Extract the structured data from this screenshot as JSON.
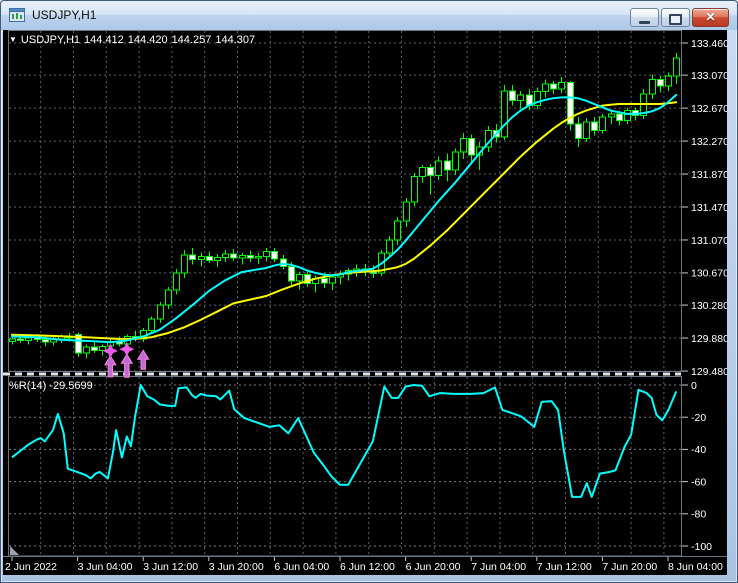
{
  "window": {
    "title": "USDJPY,H1",
    "controls": {
      "minimize": "minimize",
      "restore": "restore",
      "close": "✕"
    }
  },
  "main_chart": {
    "collapse_icon": "▼",
    "ohlc": {
      "symbol": "USDJPY,H1",
      "open": "144.412",
      "high": "144.420",
      "low": "144.257",
      "close": "144.307"
    }
  },
  "indicator": {
    "label": "%R(14) -29.5699"
  },
  "colors": {
    "background": "#000000",
    "grid": "#59636c",
    "wpr_grid": "#737d86",
    "panel_border": "#6b7680",
    "candle_outline": "#00FF00",
    "bull_fill": "#000000",
    "bear_fill": "#FFFFFF",
    "ma_fast": "#00FFFF",
    "ma_slow": "#FFFF00",
    "wpr_line": "#00FFFF",
    "signal_arrow": "#c06ad8",
    "signal_arrow_edge": "#ff80e0",
    "signal_star": "#ee5aee",
    "axis_text": "#FFFFFF",
    "tick": "#c8c8c8",
    "divider_dash": "#e0e4e9"
  },
  "chart_data": {
    "type": "candlestick",
    "symbol": "USDJPY",
    "timeframe": "H1",
    "price_axis": {
      "texts": [
        "133.460",
        "133.070",
        "132.670",
        "132.270",
        "131.870",
        "131.470",
        "131.070",
        "130.670",
        "130.280",
        "129.880",
        "129.480"
      ],
      "values": [
        133.46,
        133.07,
        132.67,
        132.27,
        131.87,
        131.47,
        131.07,
        130.67,
        130.28,
        129.88,
        129.48
      ],
      "min": 129.48,
      "max": 133.46
    },
    "wpr_axis": {
      "texts": [
        "0",
        "-20",
        "-40",
        "-60",
        "-80",
        "-100"
      ],
      "values": [
        0,
        -20,
        -40,
        -60,
        -80,
        -100
      ],
      "min": -100,
      "max": 0
    },
    "time_axis": {
      "labels": [
        "2 Jun 2022",
        "3 Jun 04:00",
        "3 Jun 12:00",
        "3 Jun 20:00",
        "6 Jun 04:00",
        "6 Jun 12:00",
        "6 Jun 20:00",
        "7 Jun 04:00",
        "7 Jun 12:00",
        "7 Jun 20:00",
        "8 Jun 04:00"
      ],
      "tick_indices": [
        0,
        8,
        16,
        24,
        32,
        40,
        48,
        56,
        64,
        72,
        80
      ]
    },
    "candles": [
      [
        129.84,
        129.9,
        129.8,
        129.87
      ],
      [
        129.87,
        129.91,
        129.82,
        129.85
      ],
      [
        129.85,
        129.89,
        129.8,
        129.88
      ],
      [
        129.88,
        129.93,
        129.83,
        129.86
      ],
      [
        129.86,
        129.9,
        129.78,
        129.83
      ],
      [
        129.83,
        129.89,
        129.79,
        129.87
      ],
      [
        129.87,
        129.92,
        129.82,
        129.9
      ],
      [
        129.9,
        129.94,
        129.84,
        129.88
      ],
      [
        129.92,
        129.95,
        129.65,
        129.7
      ],
      [
        129.7,
        129.8,
        129.63,
        129.77
      ],
      [
        129.77,
        129.83,
        129.7,
        129.73
      ],
      [
        129.73,
        129.8,
        129.67,
        129.78
      ],
      [
        129.78,
        129.86,
        129.76,
        129.84
      ],
      [
        129.84,
        129.9,
        129.78,
        129.81
      ],
      [
        129.81,
        129.92,
        129.78,
        129.9
      ],
      [
        129.9,
        129.97,
        129.84,
        129.87
      ],
      [
        129.87,
        130.0,
        129.83,
        129.97
      ],
      [
        129.97,
        130.14,
        129.93,
        130.11
      ],
      [
        130.11,
        130.32,
        130.06,
        130.28
      ],
      [
        130.28,
        130.5,
        130.23,
        130.46
      ],
      [
        130.46,
        130.72,
        130.41,
        130.67
      ],
      [
        130.67,
        130.95,
        130.61,
        130.89
      ],
      [
        130.89,
        130.97,
        130.77,
        130.83
      ],
      [
        130.83,
        130.92,
        130.75,
        130.87
      ],
      [
        130.87,
        130.93,
        130.79,
        130.82
      ],
      [
        130.82,
        130.9,
        130.74,
        130.86
      ],
      [
        130.86,
        130.95,
        130.8,
        130.9
      ],
      [
        130.9,
        130.96,
        130.82,
        130.85
      ],
      [
        130.85,
        130.91,
        130.77,
        130.88
      ],
      [
        130.88,
        130.94,
        130.8,
        130.85
      ],
      [
        130.85,
        130.92,
        130.78,
        130.87
      ],
      [
        130.87,
        130.97,
        130.81,
        130.93
      ],
      [
        130.93,
        130.97,
        130.8,
        130.84
      ],
      [
        130.84,
        130.89,
        130.71,
        130.75
      ],
      [
        130.75,
        130.8,
        130.52,
        130.57
      ],
      [
        130.57,
        130.69,
        130.47,
        130.65
      ],
      [
        130.65,
        130.71,
        130.5,
        130.54
      ],
      [
        130.54,
        130.64,
        130.43,
        130.6
      ],
      [
        130.6,
        130.67,
        130.49,
        130.55
      ],
      [
        130.55,
        130.66,
        130.46,
        130.62
      ],
      [
        130.62,
        130.7,
        130.53,
        130.66
      ],
      [
        130.66,
        130.73,
        130.58,
        130.7
      ],
      [
        130.7,
        130.77,
        130.62,
        130.72
      ],
      [
        130.72,
        130.78,
        130.63,
        130.68
      ],
      [
        130.68,
        130.76,
        130.61,
        130.67
      ],
      [
        130.67,
        130.95,
        130.63,
        130.91
      ],
      [
        130.91,
        131.12,
        130.85,
        131.07
      ],
      [
        131.07,
        131.35,
        131.01,
        131.3
      ],
      [
        131.3,
        131.58,
        131.23,
        131.53
      ],
      [
        131.53,
        131.88,
        131.48,
        131.84
      ],
      [
        131.84,
        131.98,
        131.76,
        131.95
      ],
      [
        131.95,
        131.99,
        131.62,
        131.85
      ],
      [
        131.85,
        132.08,
        131.8,
        132.03
      ],
      [
        132.03,
        132.12,
        131.78,
        131.92
      ],
      [
        131.92,
        132.18,
        131.86,
        132.14
      ],
      [
        132.14,
        132.37,
        132.05,
        132.3
      ],
      [
        132.3,
        132.35,
        132.0,
        132.1
      ],
      [
        132.1,
        132.26,
        131.92,
        132.2
      ],
      [
        132.2,
        132.45,
        132.14,
        132.4
      ],
      [
        132.4,
        132.48,
        132.25,
        132.32
      ],
      [
        132.32,
        132.95,
        132.28,
        132.88
      ],
      [
        132.88,
        132.95,
        132.7,
        132.76
      ],
      [
        132.76,
        132.88,
        132.66,
        132.83
      ],
      [
        132.83,
        132.9,
        132.64,
        132.7
      ],
      [
        132.7,
        132.92,
        132.66,
        132.87
      ],
      [
        132.87,
        133.02,
        132.8,
        132.96
      ],
      [
        132.96,
        133.0,
        132.84,
        132.9
      ],
      [
        132.9,
        133.05,
        132.85,
        132.98
      ],
      [
        132.98,
        133.0,
        132.4,
        132.48
      ],
      [
        132.48,
        132.56,
        132.2,
        132.3
      ],
      [
        132.3,
        132.55,
        132.26,
        132.5
      ],
      [
        132.5,
        132.56,
        132.34,
        132.4
      ],
      [
        132.4,
        132.6,
        132.36,
        132.56
      ],
      [
        132.56,
        132.64,
        132.48,
        132.6
      ],
      [
        132.6,
        132.64,
        132.46,
        132.52
      ],
      [
        132.52,
        132.68,
        132.48,
        132.64
      ],
      [
        132.64,
        132.68,
        132.52,
        132.58
      ],
      [
        132.58,
        132.9,
        132.54,
        132.84
      ],
      [
        132.84,
        133.08,
        132.78,
        133.02
      ],
      [
        133.02,
        133.06,
        132.86,
        132.94
      ],
      [
        132.94,
        133.1,
        132.88,
        133.06
      ],
      [
        133.06,
        133.34,
        132.96,
        133.28
      ]
    ],
    "ma_fast_cyan": [
      [
        0,
        129.9
      ],
      [
        3,
        129.89
      ],
      [
        6,
        129.86
      ],
      [
        10,
        129.84
      ],
      [
        12,
        129.83
      ],
      [
        14,
        129.85
      ],
      [
        16,
        129.9
      ],
      [
        18,
        129.98
      ],
      [
        20,
        130.12
      ],
      [
        22,
        130.28
      ],
      [
        24,
        130.45
      ],
      [
        26,
        130.58
      ],
      [
        28,
        130.68
      ],
      [
        31,
        130.73
      ],
      [
        32,
        130.76
      ],
      [
        33,
        130.78
      ],
      [
        34,
        130.77
      ],
      [
        35,
        130.74
      ],
      [
        36,
        130.7
      ],
      [
        37,
        130.67
      ],
      [
        38,
        130.65
      ],
      [
        39,
        130.64
      ],
      [
        40,
        130.65
      ],
      [
        41,
        130.68
      ],
      [
        44,
        130.72
      ],
      [
        45,
        130.78
      ],
      [
        46,
        130.86
      ],
      [
        47,
        130.95
      ],
      [
        48,
        131.06
      ],
      [
        49,
        131.18
      ],
      [
        50,
        131.3
      ],
      [
        51,
        131.42
      ],
      [
        52,
        131.54
      ],
      [
        53,
        131.65
      ],
      [
        54,
        131.76
      ],
      [
        55,
        131.88
      ],
      [
        56,
        132.0
      ],
      [
        57,
        132.12
      ],
      [
        58,
        132.24
      ],
      [
        59,
        132.35
      ],
      [
        60,
        132.46
      ],
      [
        61,
        132.56
      ],
      [
        62,
        132.64
      ],
      [
        63,
        132.7
      ],
      [
        64,
        132.74
      ],
      [
        65,
        132.77
      ],
      [
        66,
        132.79
      ],
      [
        67,
        132.8
      ],
      [
        68,
        132.8
      ],
      [
        69,
        132.79
      ],
      [
        70,
        132.76
      ],
      [
        71,
        132.72
      ],
      [
        72,
        132.68
      ],
      [
        73,
        132.64
      ],
      [
        74,
        132.62
      ],
      [
        75,
        132.6
      ],
      [
        76,
        132.6
      ],
      [
        77,
        132.61
      ],
      [
        78,
        132.63
      ],
      [
        79,
        132.67
      ],
      [
        80,
        132.74
      ],
      [
        81,
        132.83
      ]
    ],
    "ma_slow_yellow": [
      [
        0,
        129.92
      ],
      [
        4,
        129.91
      ],
      [
        9,
        129.89
      ],
      [
        13,
        129.87
      ],
      [
        15,
        129.87
      ],
      [
        17,
        129.89
      ],
      [
        19,
        129.94
      ],
      [
        21,
        130.01
      ],
      [
        23,
        130.1
      ],
      [
        25,
        130.2
      ],
      [
        27,
        130.3
      ],
      [
        31,
        130.39
      ],
      [
        33,
        130.47
      ],
      [
        35,
        130.54
      ],
      [
        37,
        130.6
      ],
      [
        39,
        130.64
      ],
      [
        41,
        130.67
      ],
      [
        45,
        130.7
      ],
      [
        47,
        130.74
      ],
      [
        48,
        130.78
      ],
      [
        49,
        130.84
      ],
      [
        50,
        130.92
      ],
      [
        51,
        131.0
      ],
      [
        52,
        131.09
      ],
      [
        53,
        131.18
      ],
      [
        54,
        131.28
      ],
      [
        55,
        131.38
      ],
      [
        56,
        131.48
      ],
      [
        57,
        131.58
      ],
      [
        58,
        131.68
      ],
      [
        59,
        131.78
      ],
      [
        60,
        131.88
      ],
      [
        61,
        131.98
      ],
      [
        62,
        132.08
      ],
      [
        63,
        132.17
      ],
      [
        64,
        132.26
      ],
      [
        65,
        132.34
      ],
      [
        66,
        132.42
      ],
      [
        67,
        132.49
      ],
      [
        68,
        132.55
      ],
      [
        69,
        132.6
      ],
      [
        70,
        132.64
      ],
      [
        71,
        132.67
      ],
      [
        72,
        132.7
      ],
      [
        73,
        132.71
      ],
      [
        74,
        132.72
      ],
      [
        75,
        132.72
      ],
      [
        77,
        132.72
      ],
      [
        79,
        132.72
      ],
      [
        80,
        132.73
      ],
      [
        81,
        132.74
      ]
    ],
    "wpr": [
      [
        0,
        -45
      ],
      [
        1,
        -41
      ],
      [
        2,
        -37
      ],
      [
        3,
        -34
      ],
      [
        3.5,
        -33
      ],
      [
        4,
        -35
      ],
      [
        5,
        -28
      ],
      [
        5.6,
        -18
      ],
      [
        6.3,
        -30
      ],
      [
        6.8,
        -52
      ],
      [
        8.5,
        -55
      ],
      [
        9,
        -56
      ],
      [
        9.6,
        -58
      ],
      [
        10.2,
        -55
      ],
      [
        10.7,
        -54
      ],
      [
        11.2,
        -56
      ],
      [
        11.7,
        -58
      ],
      [
        12.3,
        -42
      ],
      [
        12.7,
        -28
      ],
      [
        13.4,
        -45
      ],
      [
        14,
        -32
      ],
      [
        14.5,
        -38
      ],
      [
        15,
        -20
      ],
      [
        15.7,
        0
      ],
      [
        16.5,
        -7
      ],
      [
        17.3,
        -9
      ],
      [
        18,
        -12
      ],
      [
        19.1,
        -13
      ],
      [
        19.9,
        -13
      ],
      [
        20.3,
        -2
      ],
      [
        21.3,
        -1.5
      ],
      [
        21.9,
        -6
      ],
      [
        22.4,
        -8
      ],
      [
        23,
        -5.5
      ],
      [
        23.7,
        -6.5
      ],
      [
        24.9,
        -7
      ],
      [
        25.4,
        -9
      ],
      [
        26.5,
        -3.5
      ],
      [
        27.1,
        -15
      ],
      [
        28.3,
        -20.5
      ],
      [
        31.4,
        -26
      ],
      [
        32.6,
        -25
      ],
      [
        33.7,
        -30
      ],
      [
        34.9,
        -20.5
      ],
      [
        36,
        -33
      ],
      [
        36.8,
        -42
      ],
      [
        38,
        -50
      ],
      [
        39,
        -57
      ],
      [
        40,
        -62
      ],
      [
        41,
        -62
      ],
      [
        44,
        -35
      ],
      [
        45.4,
        -1
      ],
      [
        46.3,
        -8
      ],
      [
        47.1,
        -8
      ],
      [
        48,
        -1
      ],
      [
        49,
        0
      ],
      [
        50,
        -0.5
      ],
      [
        50.9,
        -7
      ],
      [
        52.2,
        -5
      ],
      [
        54,
        -5.5
      ],
      [
        56,
        -5.5
      ],
      [
        57.5,
        -5
      ],
      [
        58.9,
        -1.5
      ],
      [
        59.8,
        -15.5
      ],
      [
        61,
        -17.5
      ],
      [
        62.1,
        -19.5
      ],
      [
        63.7,
        -26
      ],
      [
        64.6,
        -10.5
      ],
      [
        65.8,
        -10
      ],
      [
        66.6,
        -15.5
      ],
      [
        67.3,
        -41
      ],
      [
        68.3,
        -69.5
      ],
      [
        69.4,
        -69.5
      ],
      [
        70.1,
        -61
      ],
      [
        70.7,
        -69.5
      ],
      [
        71.7,
        -55
      ],
      [
        72.9,
        -54
      ],
      [
        73.6,
        -53
      ],
      [
        74.7,
        -38.5
      ],
      [
        75.5,
        -31
      ],
      [
        76.4,
        -3
      ],
      [
        77.4,
        -5
      ],
      [
        78,
        -8
      ],
      [
        78.6,
        -18.6
      ],
      [
        79.3,
        -22
      ],
      [
        80.1,
        -15
      ],
      [
        81,
        -4
      ]
    ],
    "buy_signals": [
      {
        "index": 12,
        "star": true,
        "tail": 12
      },
      {
        "index": 14,
        "star": true,
        "tail": 14
      },
      {
        "index": 16,
        "star": false,
        "tail": 10
      }
    ]
  }
}
